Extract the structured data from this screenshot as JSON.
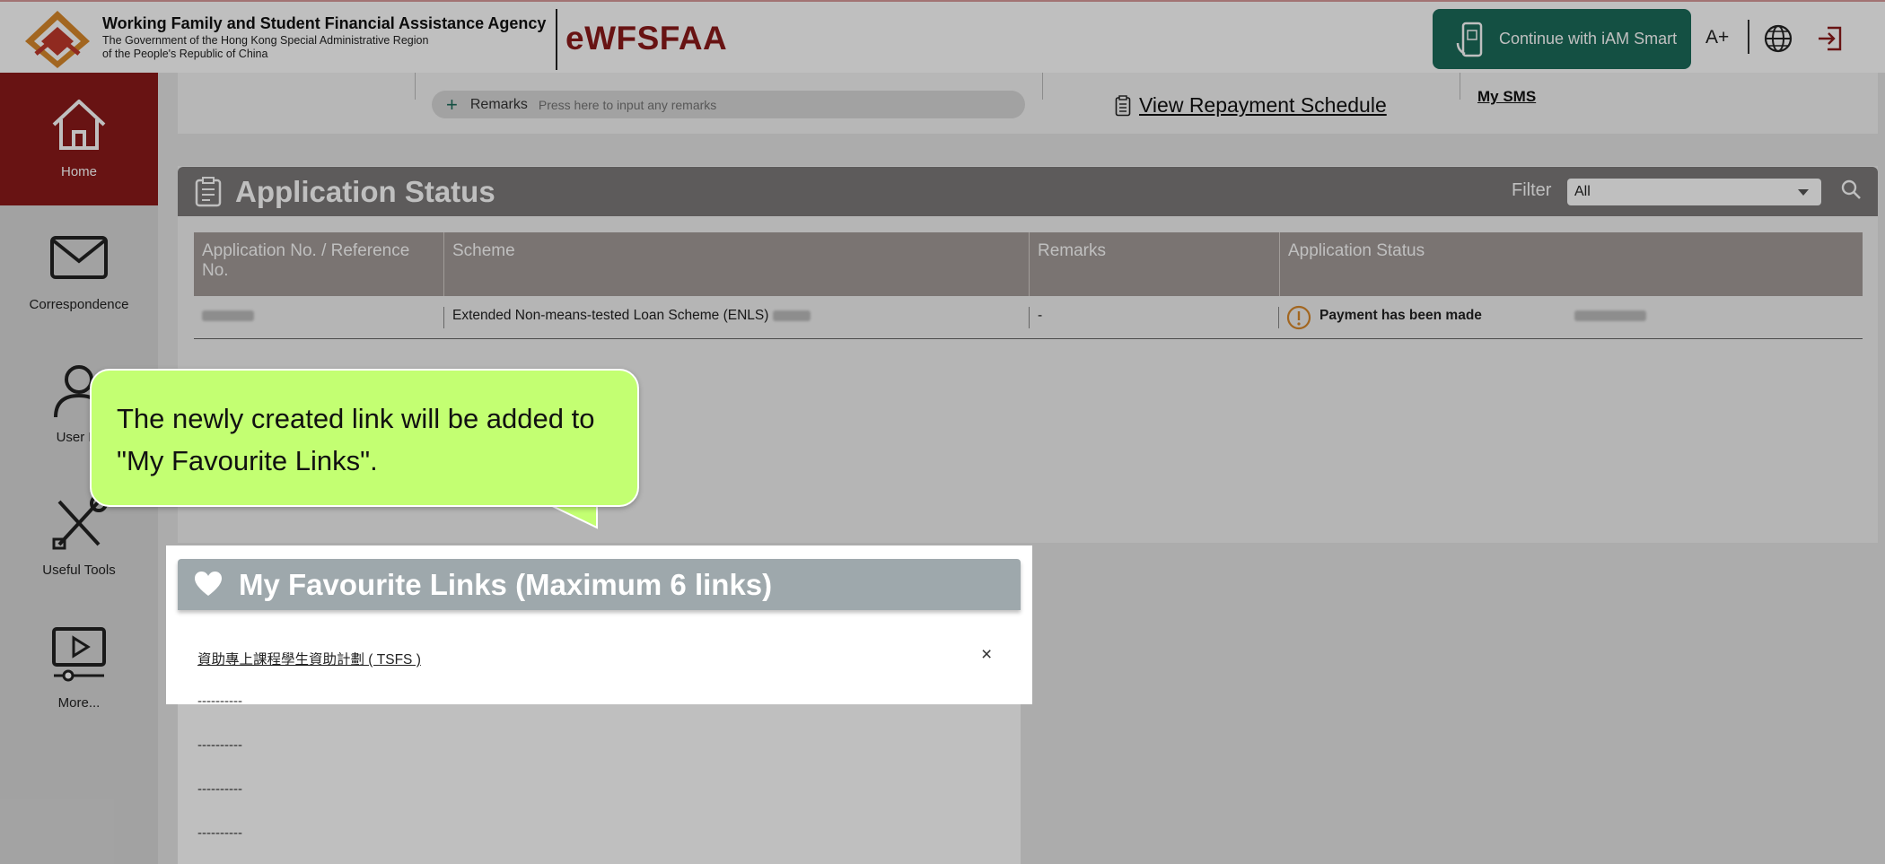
{
  "header": {
    "org_name": "Working Family and Student Financial Assistance Agency",
    "org_sub1": "The Government of the Hong Kong Special Administrative Region",
    "org_sub2": "of the People's Republic of China",
    "brand": "eWFSFAA",
    "iam_smart_label": "Continue with iAM Smart",
    "font_size_label": "A+",
    "icons": [
      "agency-logo-icon",
      "iam-smart-phone-icon",
      "globe-icon",
      "logout-icon"
    ]
  },
  "sidebar": {
    "items": [
      {
        "label": "Home",
        "icon": "home-icon",
        "active": true
      },
      {
        "label": "Correspondence",
        "icon": "envelope-icon",
        "active": false
      },
      {
        "label": "User Pr",
        "icon": "user-icon",
        "active": false
      },
      {
        "label": "Useful Tools",
        "icon": "tools-icon",
        "active": false
      },
      {
        "label": "More...",
        "icon": "video-icon",
        "active": false
      }
    ]
  },
  "top_strip": {
    "remarks_label": "Remarks",
    "remarks_placeholder": "Press here to input any remarks",
    "repayment_link": "View Repayment Schedule",
    "sms_link": "My SMS"
  },
  "application_status": {
    "title": "Application Status",
    "filter_label": "Filter",
    "filter_value": "All",
    "columns": [
      "Application No. / Reference No.",
      "Scheme",
      "Remarks",
      "Application Status"
    ],
    "rows": [
      {
        "scheme": "Extended Non-means-tested Loan Scheme (ENLS)",
        "remarks": "-",
        "status": "Payment has been made"
      }
    ]
  },
  "favourite_links": {
    "title": "My Favourite Links (Maximum 6 links)",
    "link": "資助專上課程學生資助計劃 ( TSFS )",
    "close": "×",
    "empty_slots": [
      "----------",
      "----------",
      "----------",
      "----------"
    ]
  },
  "callout": {
    "text": "The newly created link will be added to \"My Favourite Links\"."
  },
  "colors": {
    "brand_red": "#8b1a1a",
    "iam_green": "#1b6b5a",
    "callout_green": "#c3ff72",
    "status_orange": "#d9892b"
  }
}
